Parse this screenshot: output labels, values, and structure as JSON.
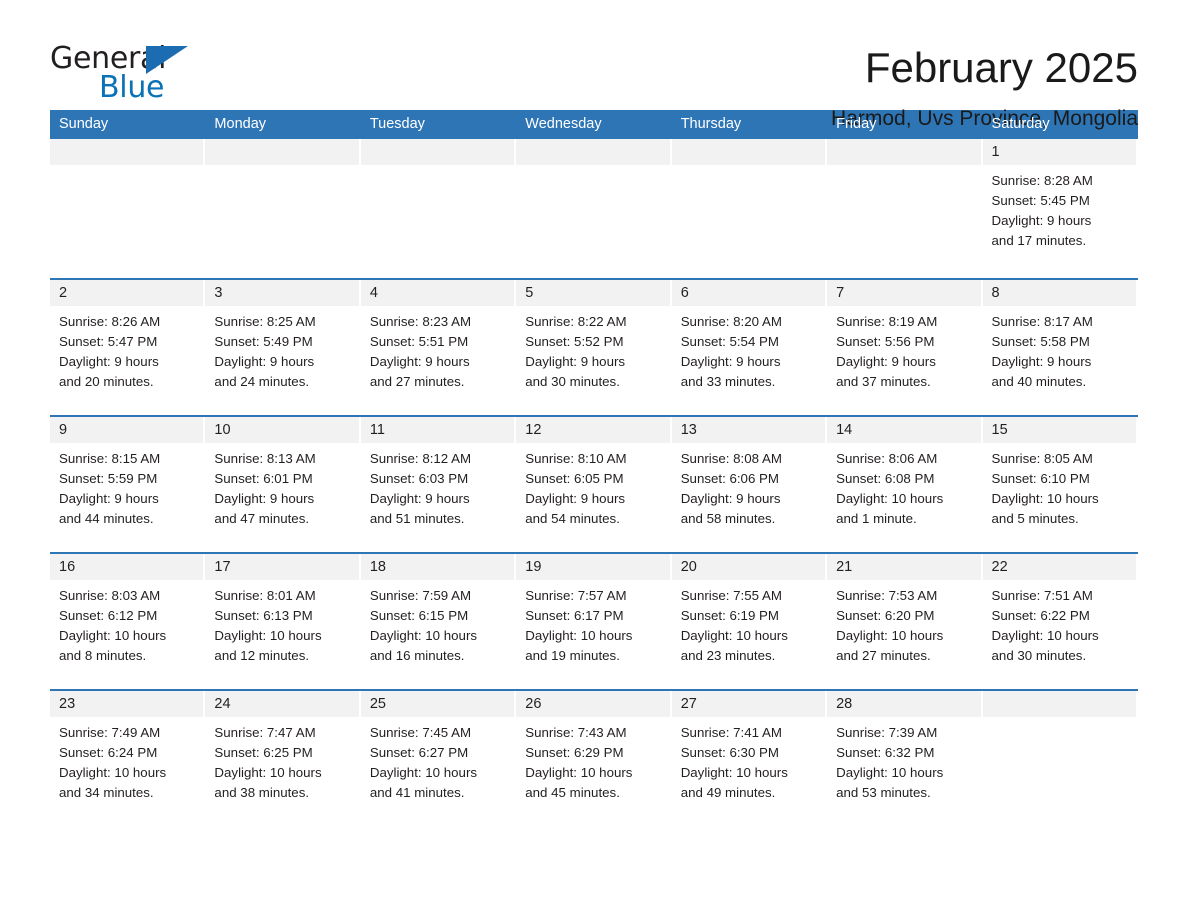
{
  "brand": {
    "name_part1": "General",
    "name_part2": "Blue",
    "accent_color": "#1b6cb0",
    "triangle_icon": "triangle-icon"
  },
  "header": {
    "month_title": "February 2025",
    "location": "Harmod, Uvs Province, Mongolia"
  },
  "theme": {
    "header_blue": "#2e75b6",
    "day_band_gray": "#f2f2f2",
    "text_color": "#231f20"
  },
  "weekdays": [
    "Sunday",
    "Monday",
    "Tuesday",
    "Wednesday",
    "Thursday",
    "Friday",
    "Saturday"
  ],
  "weeks": [
    [
      {
        "day": "",
        "sunrise": "",
        "sunset": "",
        "daylight_line1": "",
        "daylight_line2": "",
        "empty": true
      },
      {
        "day": "",
        "sunrise": "",
        "sunset": "",
        "daylight_line1": "",
        "daylight_line2": "",
        "empty": true
      },
      {
        "day": "",
        "sunrise": "",
        "sunset": "",
        "daylight_line1": "",
        "daylight_line2": "",
        "empty": true
      },
      {
        "day": "",
        "sunrise": "",
        "sunset": "",
        "daylight_line1": "",
        "daylight_line2": "",
        "empty": true
      },
      {
        "day": "",
        "sunrise": "",
        "sunset": "",
        "daylight_line1": "",
        "daylight_line2": "",
        "empty": true
      },
      {
        "day": "",
        "sunrise": "",
        "sunset": "",
        "daylight_line1": "",
        "daylight_line2": "",
        "empty": true
      },
      {
        "day": "1",
        "sunrise": "Sunrise: 8:28 AM",
        "sunset": "Sunset: 5:45 PM",
        "daylight_line1": "Daylight: 9 hours",
        "daylight_line2": "and 17 minutes."
      }
    ],
    [
      {
        "day": "2",
        "sunrise": "Sunrise: 8:26 AM",
        "sunset": "Sunset: 5:47 PM",
        "daylight_line1": "Daylight: 9 hours",
        "daylight_line2": "and 20 minutes."
      },
      {
        "day": "3",
        "sunrise": "Sunrise: 8:25 AM",
        "sunset": "Sunset: 5:49 PM",
        "daylight_line1": "Daylight: 9 hours",
        "daylight_line2": "and 24 minutes."
      },
      {
        "day": "4",
        "sunrise": "Sunrise: 8:23 AM",
        "sunset": "Sunset: 5:51 PM",
        "daylight_line1": "Daylight: 9 hours",
        "daylight_line2": "and 27 minutes."
      },
      {
        "day": "5",
        "sunrise": "Sunrise: 8:22 AM",
        "sunset": "Sunset: 5:52 PM",
        "daylight_line1": "Daylight: 9 hours",
        "daylight_line2": "and 30 minutes."
      },
      {
        "day": "6",
        "sunrise": "Sunrise: 8:20 AM",
        "sunset": "Sunset: 5:54 PM",
        "daylight_line1": "Daylight: 9 hours",
        "daylight_line2": "and 33 minutes."
      },
      {
        "day": "7",
        "sunrise": "Sunrise: 8:19 AM",
        "sunset": "Sunset: 5:56 PM",
        "daylight_line1": "Daylight: 9 hours",
        "daylight_line2": "and 37 minutes."
      },
      {
        "day": "8",
        "sunrise": "Sunrise: 8:17 AM",
        "sunset": "Sunset: 5:58 PM",
        "daylight_line1": "Daylight: 9 hours",
        "daylight_line2": "and 40 minutes."
      }
    ],
    [
      {
        "day": "9",
        "sunrise": "Sunrise: 8:15 AM",
        "sunset": "Sunset: 5:59 PM",
        "daylight_line1": "Daylight: 9 hours",
        "daylight_line2": "and 44 minutes."
      },
      {
        "day": "10",
        "sunrise": "Sunrise: 8:13 AM",
        "sunset": "Sunset: 6:01 PM",
        "daylight_line1": "Daylight: 9 hours",
        "daylight_line2": "and 47 minutes."
      },
      {
        "day": "11",
        "sunrise": "Sunrise: 8:12 AM",
        "sunset": "Sunset: 6:03 PM",
        "daylight_line1": "Daylight: 9 hours",
        "daylight_line2": "and 51 minutes."
      },
      {
        "day": "12",
        "sunrise": "Sunrise: 8:10 AM",
        "sunset": "Sunset: 6:05 PM",
        "daylight_line1": "Daylight: 9 hours",
        "daylight_line2": "and 54 minutes."
      },
      {
        "day": "13",
        "sunrise": "Sunrise: 8:08 AM",
        "sunset": "Sunset: 6:06 PM",
        "daylight_line1": "Daylight: 9 hours",
        "daylight_line2": "and 58 minutes."
      },
      {
        "day": "14",
        "sunrise": "Sunrise: 8:06 AM",
        "sunset": "Sunset: 6:08 PM",
        "daylight_line1": "Daylight: 10 hours",
        "daylight_line2": "and 1 minute."
      },
      {
        "day": "15",
        "sunrise": "Sunrise: 8:05 AM",
        "sunset": "Sunset: 6:10 PM",
        "daylight_line1": "Daylight: 10 hours",
        "daylight_line2": "and 5 minutes."
      }
    ],
    [
      {
        "day": "16",
        "sunrise": "Sunrise: 8:03 AM",
        "sunset": "Sunset: 6:12 PM",
        "daylight_line1": "Daylight: 10 hours",
        "daylight_line2": "and 8 minutes."
      },
      {
        "day": "17",
        "sunrise": "Sunrise: 8:01 AM",
        "sunset": "Sunset: 6:13 PM",
        "daylight_line1": "Daylight: 10 hours",
        "daylight_line2": "and 12 minutes."
      },
      {
        "day": "18",
        "sunrise": "Sunrise: 7:59 AM",
        "sunset": "Sunset: 6:15 PM",
        "daylight_line1": "Daylight: 10 hours",
        "daylight_line2": "and 16 minutes."
      },
      {
        "day": "19",
        "sunrise": "Sunrise: 7:57 AM",
        "sunset": "Sunset: 6:17 PM",
        "daylight_line1": "Daylight: 10 hours",
        "daylight_line2": "and 19 minutes."
      },
      {
        "day": "20",
        "sunrise": "Sunrise: 7:55 AM",
        "sunset": "Sunset: 6:19 PM",
        "daylight_line1": "Daylight: 10 hours",
        "daylight_line2": "and 23 minutes."
      },
      {
        "day": "21",
        "sunrise": "Sunrise: 7:53 AM",
        "sunset": "Sunset: 6:20 PM",
        "daylight_line1": "Daylight: 10 hours",
        "daylight_line2": "and 27 minutes."
      },
      {
        "day": "22",
        "sunrise": "Sunrise: 7:51 AM",
        "sunset": "Sunset: 6:22 PM",
        "daylight_line1": "Daylight: 10 hours",
        "daylight_line2": "and 30 minutes."
      }
    ],
    [
      {
        "day": "23",
        "sunrise": "Sunrise: 7:49 AM",
        "sunset": "Sunset: 6:24 PM",
        "daylight_line1": "Daylight: 10 hours",
        "daylight_line2": "and 34 minutes."
      },
      {
        "day": "24",
        "sunrise": "Sunrise: 7:47 AM",
        "sunset": "Sunset: 6:25 PM",
        "daylight_line1": "Daylight: 10 hours",
        "daylight_line2": "and 38 minutes."
      },
      {
        "day": "25",
        "sunrise": "Sunrise: 7:45 AM",
        "sunset": "Sunset: 6:27 PM",
        "daylight_line1": "Daylight: 10 hours",
        "daylight_line2": "and 41 minutes."
      },
      {
        "day": "26",
        "sunrise": "Sunrise: 7:43 AM",
        "sunset": "Sunset: 6:29 PM",
        "daylight_line1": "Daylight: 10 hours",
        "daylight_line2": "and 45 minutes."
      },
      {
        "day": "27",
        "sunrise": "Sunrise: 7:41 AM",
        "sunset": "Sunset: 6:30 PM",
        "daylight_line1": "Daylight: 10 hours",
        "daylight_line2": "and 49 minutes."
      },
      {
        "day": "28",
        "sunrise": "Sunrise: 7:39 AM",
        "sunset": "Sunset: 6:32 PM",
        "daylight_line1": "Daylight: 10 hours",
        "daylight_line2": "and 53 minutes."
      },
      {
        "day": "",
        "sunrise": "",
        "sunset": "",
        "daylight_line1": "",
        "daylight_line2": "",
        "empty": true
      }
    ]
  ]
}
